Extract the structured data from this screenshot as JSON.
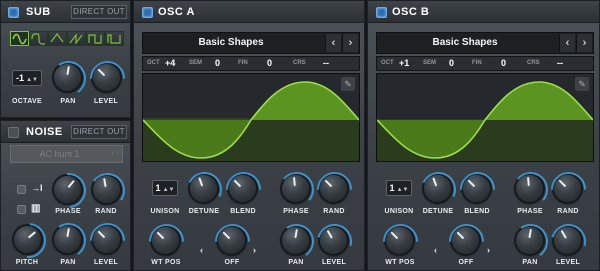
{
  "sub": {
    "title": "SUB",
    "direct_out": "DIRECT OUT",
    "waveforms": [
      "sine-wave-icon",
      "rounded-square-wave-icon",
      "triangle-wave-icon",
      "saw-wave-icon",
      "square-wave-icon",
      "pulse-wave-icon"
    ],
    "octave": {
      "value": "-1",
      "label": "OCTAVE"
    },
    "pan_label": "PAN",
    "level_label": "LEVEL"
  },
  "noise": {
    "title": "NOISE",
    "direct_out": "DIRECT OUT",
    "preset": "AC hum 1",
    "phase_label": "PHASE",
    "rand_label": "RAND",
    "pitch_label": "PITCH",
    "pan_label": "PAN",
    "level_label": "LEVEL",
    "icons": [
      "retrigger-arrow-icon",
      "keytrack-piano-icon"
    ]
  },
  "osc_a": {
    "title": "OSC A",
    "wavetable": "Basic Shapes",
    "oct_key": "OCT",
    "oct": "+4",
    "sem_key": "SEM",
    "sem": "0",
    "fin_key": "FIN",
    "fin": "0",
    "crs_key": "CRS",
    "crs": "--",
    "unison": "1",
    "labels": {
      "unison": "UNISON",
      "detune": "DETUNE",
      "blend": "BLEND",
      "phase": "PHASE",
      "rand": "RAND",
      "wtpos": "WT POS",
      "off": "OFF",
      "pan": "PAN",
      "level": "LEVEL"
    }
  },
  "osc_b": {
    "title": "OSC B",
    "wavetable": "Basic Shapes",
    "oct_key": "OCT",
    "oct": "+1",
    "sem_key": "SEM",
    "sem": "0",
    "fin_key": "FIN",
    "fin": "0",
    "crs_key": "CRS",
    "crs": "--",
    "unison": "1",
    "labels": {
      "unison": "UNISON",
      "detune": "DETUNE",
      "blend": "BLEND",
      "phase": "PHASE",
      "rand": "RAND",
      "wtpos": "WT POS",
      "off": "OFF",
      "pan": "PAN",
      "level": "LEVEL"
    }
  },
  "colors": {
    "accent": "#3fa3e8",
    "wave": "#7cc23a",
    "wave_fill": "#4f7d1f"
  }
}
